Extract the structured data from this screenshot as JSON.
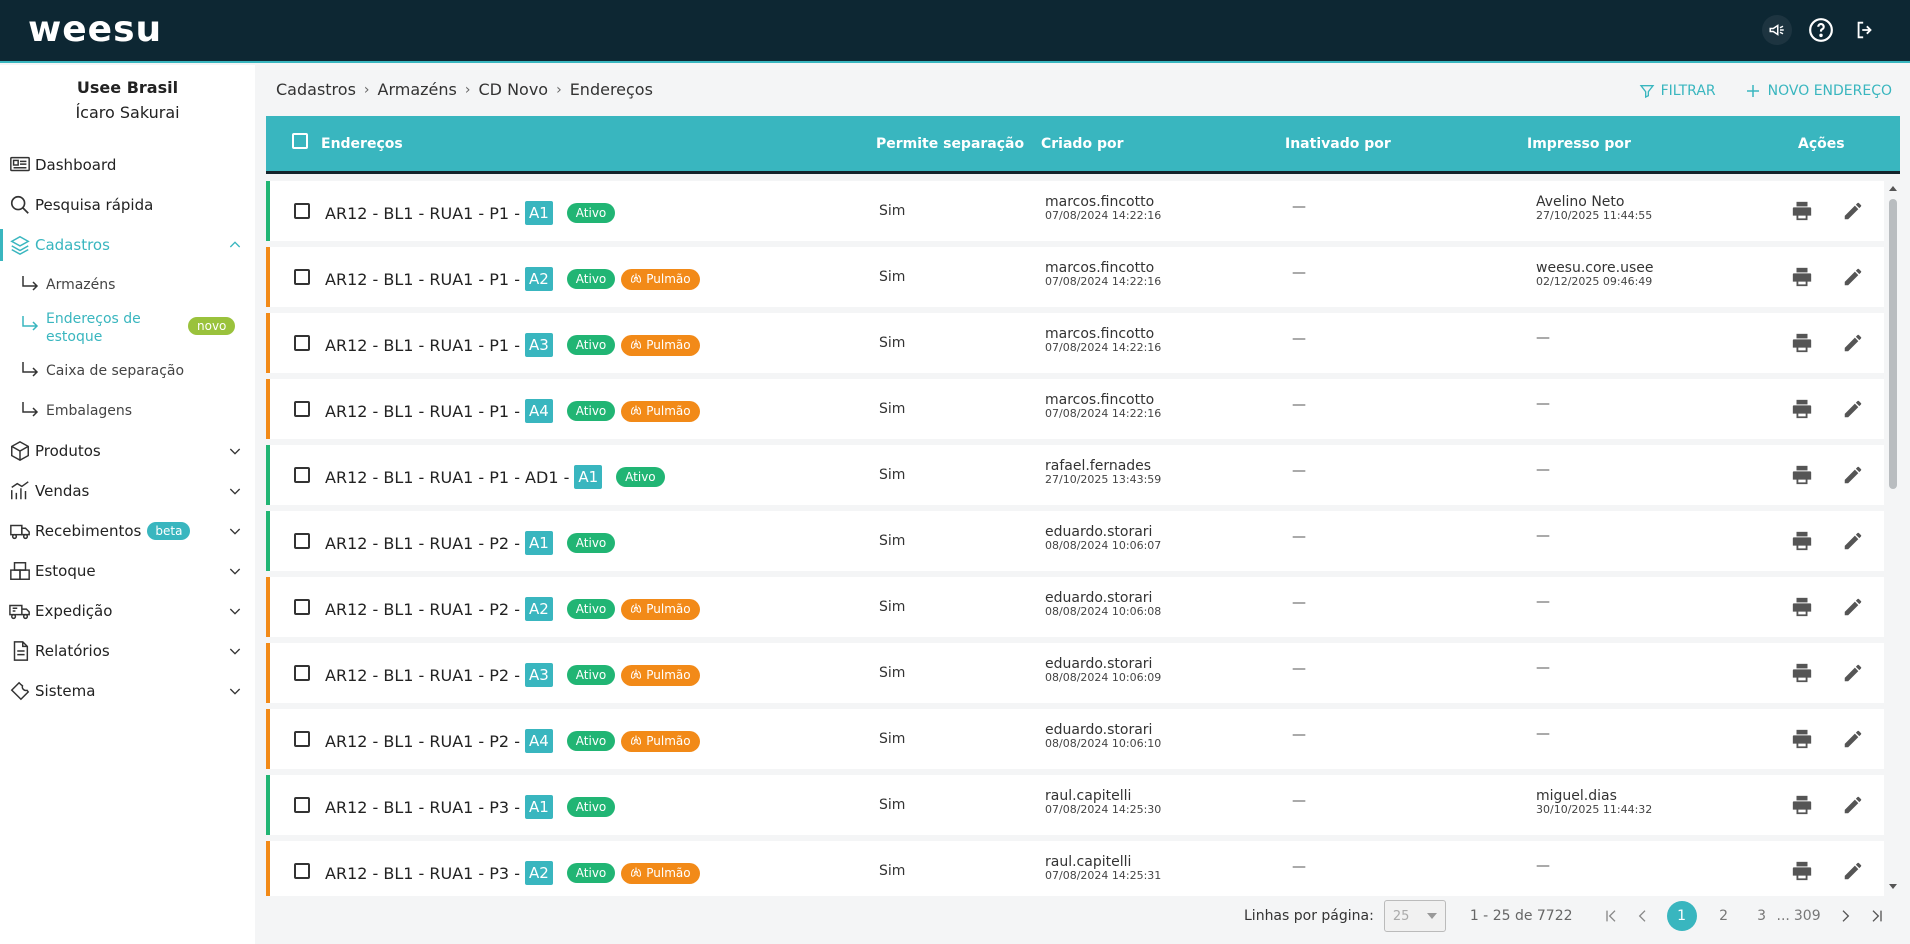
{
  "app": {
    "logo": "weesu"
  },
  "sidebar": {
    "org": "Usee Brasil",
    "user": "Ícaro Sakurai",
    "items": [
      {
        "label": "Dashboard"
      },
      {
        "label": "Pesquisa rápida"
      },
      {
        "label": "Cadastros"
      },
      {
        "label": "Produtos"
      },
      {
        "label": "Vendas"
      },
      {
        "label": "Recebimentos",
        "badge": "beta"
      },
      {
        "label": "Estoque"
      },
      {
        "label": "Expedição"
      },
      {
        "label": "Relatórios"
      },
      {
        "label": "Sistema"
      }
    ],
    "subitems": [
      {
        "label": "Armazéns"
      },
      {
        "label": "Endereços de estoque",
        "badge": "novo"
      },
      {
        "label": "Caixa de separação"
      },
      {
        "label": "Embalagens"
      }
    ]
  },
  "breadcrumb": [
    "Cadastros",
    "Armazéns",
    "CD Novo",
    "Endereços"
  ],
  "actions": {
    "filter": "FILTRAR",
    "new": "NOVO ENDEREÇO"
  },
  "table": {
    "headers": {
      "address": "Endereços",
      "separation": "Permite separação",
      "created_by": "Criado por",
      "inactivated_by": "Inativado por",
      "printed_by": "Impresso por",
      "actions": "Ações"
    },
    "status_label": "Ativo",
    "pulmao_label": "Pulmão",
    "rows": [
      {
        "address": "AR12 - BL1 - RUA1 - P1 -",
        "code": "A1",
        "pulmao": false,
        "separation": "Sim",
        "created_by": "marcos.fincotto",
        "created_at": "07/08/2024 14:22:16",
        "inactivated_by": "—",
        "printed_by": "Avelino Neto",
        "printed_at": "27/10/2025 11:44:55"
      },
      {
        "address": "AR12 - BL1 - RUA1 - P1 -",
        "code": "A2",
        "pulmao": true,
        "separation": "Sim",
        "created_by": "marcos.fincotto",
        "created_at": "07/08/2024 14:22:16",
        "inactivated_by": "—",
        "printed_by": "weesu.core.usee",
        "printed_at": "02/12/2025 09:46:49"
      },
      {
        "address": "AR12 - BL1 - RUA1 - P1 -",
        "code": "A3",
        "pulmao": true,
        "separation": "Sim",
        "created_by": "marcos.fincotto",
        "created_at": "07/08/2024 14:22:16",
        "inactivated_by": "—",
        "printed_by": "—",
        "printed_at": ""
      },
      {
        "address": "AR12 - BL1 - RUA1 - P1 -",
        "code": "A4",
        "pulmao": true,
        "separation": "Sim",
        "created_by": "marcos.fincotto",
        "created_at": "07/08/2024 14:22:16",
        "inactivated_by": "—",
        "printed_by": "—",
        "printed_at": ""
      },
      {
        "address": "AR12 - BL1 - RUA1 - P1 - AD1 -",
        "code": "A1",
        "pulmao": false,
        "separation": "Sim",
        "created_by": "rafael.fernades",
        "created_at": "27/10/2025 13:43:59",
        "inactivated_by": "—",
        "printed_by": "—",
        "printed_at": ""
      },
      {
        "address": "AR12 - BL1 - RUA1 - P2 -",
        "code": "A1",
        "pulmao": false,
        "separation": "Sim",
        "created_by": "eduardo.storari",
        "created_at": "08/08/2024 10:06:07",
        "inactivated_by": "—",
        "printed_by": "—",
        "printed_at": ""
      },
      {
        "address": "AR12 - BL1 - RUA1 - P2 -",
        "code": "A2",
        "pulmao": true,
        "separation": "Sim",
        "created_by": "eduardo.storari",
        "created_at": "08/08/2024 10:06:08",
        "inactivated_by": "—",
        "printed_by": "—",
        "printed_at": ""
      },
      {
        "address": "AR12 - BL1 - RUA1 - P2 -",
        "code": "A3",
        "pulmao": true,
        "separation": "Sim",
        "created_by": "eduardo.storari",
        "created_at": "08/08/2024 10:06:09",
        "inactivated_by": "—",
        "printed_by": "—",
        "printed_at": ""
      },
      {
        "address": "AR12 - BL1 - RUA1 - P2 -",
        "code": "A4",
        "pulmao": true,
        "separation": "Sim",
        "created_by": "eduardo.storari",
        "created_at": "08/08/2024 10:06:10",
        "inactivated_by": "—",
        "printed_by": "—",
        "printed_at": ""
      },
      {
        "address": "AR12 - BL1 - RUA1 - P3 -",
        "code": "A1",
        "pulmao": false,
        "separation": "Sim",
        "created_by": "raul.capitelli",
        "created_at": "07/08/2024 14:25:30",
        "inactivated_by": "—",
        "printed_by": "miguel.dias",
        "printed_at": "30/10/2025 11:44:32"
      },
      {
        "address": "AR12 - BL1 - RUA1 - P3 -",
        "code": "A2",
        "pulmao": true,
        "separation": "Sim",
        "created_by": "raul.capitelli",
        "created_at": "07/08/2024 14:25:31",
        "inactivated_by": "—",
        "printed_by": "—",
        "printed_at": ""
      }
    ]
  },
  "footer": {
    "rows_per_page_label": "Linhas por página:",
    "rows_per_page_value": "25",
    "range": "1 - 25 de 7722",
    "pages": [
      "1",
      "2",
      "3"
    ],
    "ellipsis": "...",
    "last_page": "309"
  },
  "colors": {
    "accent": "#39b6bf",
    "topbar": "#0d2733",
    "active_green": "#21b574",
    "pulmao_orange": "#f28a18",
    "novo_badge": "#9ac23c"
  },
  "icons": [
    "megaphone-icon",
    "help-icon",
    "logout-icon",
    "dashboard-icon",
    "search-icon",
    "layers-icon",
    "box-icon",
    "sales-icon",
    "truck-icon",
    "warehouse-icon",
    "shipping-icon",
    "report-icon",
    "wrench-icon",
    "filter-icon",
    "plus-icon",
    "lungs-icon",
    "print-icon",
    "pencil-icon"
  ]
}
